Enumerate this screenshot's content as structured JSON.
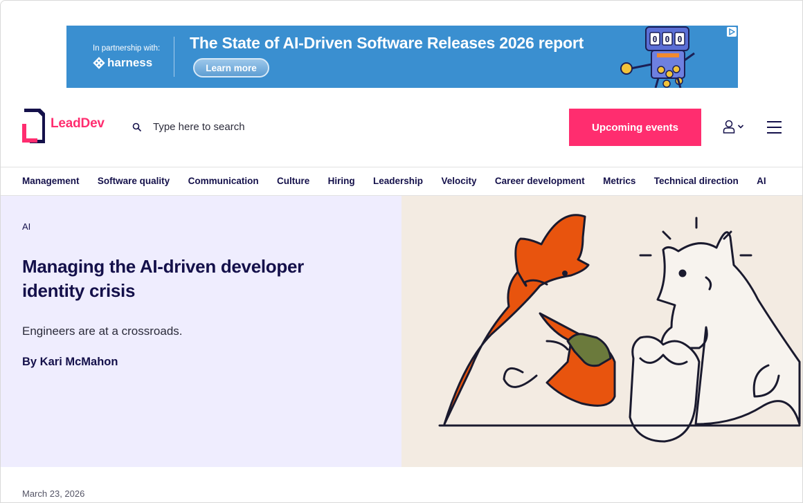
{
  "ad": {
    "partner_label": "In partnership with:",
    "partner_brand": "harness",
    "title": "The State of AI-Driven Software Releases 2026 report",
    "cta_label": "Learn more",
    "counter": "000"
  },
  "header": {
    "logo_text": "LeadDev",
    "search_placeholder": "Type here to search",
    "events_button": "Upcoming events"
  },
  "nav": {
    "items": [
      "Management",
      "Software quality",
      "Communication",
      "Culture",
      "Hiring",
      "Leadership",
      "Velocity",
      "Career development",
      "Metrics",
      "Technical direction",
      "AI"
    ]
  },
  "article": {
    "category": "AI",
    "title": "Managing the AI-driven developer identity crisis",
    "subtitle": "Engineers are at a crossroads.",
    "author": "By Kari McMahon",
    "date": "March 23, 2026"
  },
  "colors": {
    "brand_pink": "#ff2d6f",
    "navy": "#14104a",
    "ad_blue": "#3a8fd0",
    "hero_lavender": "#efedfe",
    "hero_beige": "#f3ebe2",
    "figure_orange": "#e8540e",
    "figure_green": "#6b7a3c"
  }
}
